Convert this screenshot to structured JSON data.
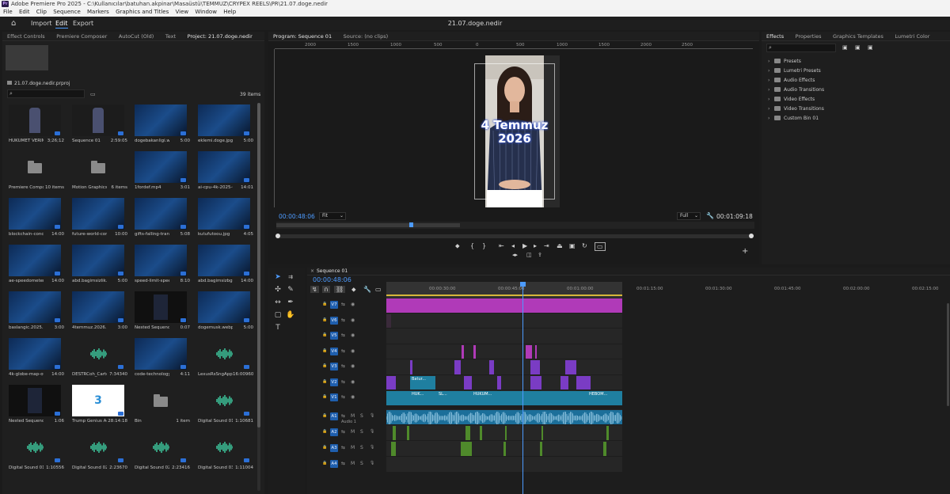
{
  "window": {
    "title": "Adobe Premiere Pro 2025 - C:\\Kullanıcılar\\batuhan.akpinar\\Masaüstü\\TEMMUZ\\CRYPEX REELS\\PR\\21.07.doge.nedir",
    "app_icon_label": "Pr"
  },
  "menu": [
    "File",
    "Edit",
    "Clip",
    "Sequence",
    "Markers",
    "Graphics and Titles",
    "View",
    "Window",
    "Help"
  ],
  "workspace": {
    "tabs": [
      "Import",
      "Edit",
      "Export"
    ],
    "active": "Edit",
    "document_title": "21.07.doge.nedir"
  },
  "project_panel": {
    "tabs": [
      "Effect Controls",
      "Premiere Composer",
      "AutoCut (Old)",
      "Text",
      "Project: 21.07.doge.nedir"
    ],
    "active_tab": "Project: 21.07.doge.nedir",
    "file_name": "21.07.doge.nedir.prproj",
    "item_count": "39 items",
    "items": [
      {
        "name": "HUKUMET VERIM...",
        "duration": "3;26;12",
        "kind": "video-portrait"
      },
      {
        "name": "Sequence 01",
        "duration": "2:59:05",
        "kind": "video-portrait"
      },
      {
        "name": "dogebakanligi.webp",
        "duration": "5:00",
        "kind": "image"
      },
      {
        "name": "eklemi.doge.jpg",
        "duration": "5:00",
        "kind": "image"
      },
      {
        "name": "Premiere Compo...",
        "duration": "10 items",
        "kind": "folder"
      },
      {
        "name": "Motion Graphics T...",
        "duration": "6 items",
        "kind": "folder"
      },
      {
        "name": "1fordef.mp4",
        "duration": "3:01",
        "kind": "video"
      },
      {
        "name": "ai-cpu-4k-2025-01-1...",
        "duration": "14:01",
        "kind": "video"
      },
      {
        "name": "blockchain-concept-...",
        "duration": "14:00",
        "kind": "video"
      },
      {
        "name": "future-world-concep...",
        "duration": "10:00",
        "kind": "video"
      },
      {
        "name": "gifts-falling-transition...",
        "duration": "5:08",
        "kind": "video"
      },
      {
        "name": "kutufutoou.jpg",
        "duration": "4:05",
        "kind": "image"
      },
      {
        "name": "ae-speedometer-and-...",
        "duration": "14:00",
        "kind": "video"
      },
      {
        "name": "abd.bagimsizlik.jpg",
        "duration": "5:00",
        "kind": "image"
      },
      {
        "name": "speed-limit-speedom...",
        "duration": "8:10",
        "kind": "video"
      },
      {
        "name": "abd.bagimsizbgn.250...",
        "duration": "14:00",
        "kind": "image"
      },
      {
        "name": "baslangic.2025.avi",
        "duration": "3:00",
        "kind": "video"
      },
      {
        "name": "4temmuz.2026.avi",
        "duration": "3:00",
        "kind": "video"
      },
      {
        "name": "Nested Sequence 01",
        "duration": "0:07",
        "kind": "sequence"
      },
      {
        "name": "dogemusk.webp",
        "duration": "5:00",
        "kind": "image"
      },
      {
        "name": "4k-globe-map-of-lar...",
        "duration": "14:00",
        "kind": "video"
      },
      {
        "name": "DESTRCoh_Carto...",
        "duration": "7:34340",
        "kind": "audio"
      },
      {
        "name": "code-technology-bac...",
        "duration": "4:11",
        "kind": "video"
      },
      {
        "name": "LexusRsSngApp...",
        "duration": "16:00960",
        "kind": "audio"
      },
      {
        "name": "Nested Sequence 02",
        "duration": "1:06",
        "kind": "sequence"
      },
      {
        "name": "Trump Genius Ac...",
        "duration": "28:14:18",
        "kind": "video",
        "thumb_text": "3"
      },
      {
        "name": "Bin",
        "duration": "1 item",
        "kind": "folder"
      },
      {
        "name": "Digital Sound 01...",
        "duration": "1:10681",
        "kind": "audio"
      },
      {
        "name": "Digital Sound 01...",
        "duration": "1:10556",
        "kind": "audio"
      },
      {
        "name": "Digital Sound 02...",
        "duration": "2:23670",
        "kind": "audio"
      },
      {
        "name": "Digital Sound 02...",
        "duration": "2:23416",
        "kind": "audio"
      },
      {
        "name": "Digital Sound 03...",
        "duration": "1:11004",
        "kind": "audio"
      }
    ]
  },
  "monitor": {
    "tabs": [
      "Program: Sequence 01",
      "Source: (no clips)"
    ],
    "active_tab": "Program: Sequence 01",
    "ruler_labels": [
      "2000",
      "1500",
      "1000",
      "500",
      "0",
      "500",
      "1000",
      "1500",
      "2000",
      "2500"
    ],
    "overlay_text_line1": "4 Temmuz",
    "overlay_text_line2": "2026",
    "current_time": "00:00:48:06",
    "zoom": "Fit",
    "quality": "Full",
    "duration": "00:01:09:18"
  },
  "effects_panel": {
    "tabs": [
      "Effects",
      "Properties",
      "Graphics Templates",
      "Lumetri Color"
    ],
    "active_tab": "Effects",
    "items": [
      "Presets",
      "Lumetri Presets",
      "Audio Effects",
      "Audio Transitions",
      "Video Effects",
      "Video Transitions",
      "Custom Bin 01"
    ]
  },
  "timeline": {
    "sequence_tab": "Sequence 01",
    "current_time": "00:00:48:06",
    "ruler_labels": [
      "00:00:30:00",
      "00:00:45:00",
      "00:01:00:00",
      "00:01:15:00",
      "00:01:30:00",
      "00:01:45:00",
      "00:02:00:00",
      "00:02:15:00"
    ],
    "video_tracks": [
      "V7",
      "V6",
      "V5",
      "V4",
      "V3",
      "V2",
      "V1"
    ],
    "audio_tracks": [
      "A1",
      "A2",
      "A3",
      "A4"
    ],
    "audio_track_name": "Audio 1",
    "clip_labels": [
      "Batur...",
      "HUK...",
      "SL...",
      "HUKUM...",
      "HEBOM..."
    ],
    "colors": {
      "pink": "#b03ab8",
      "purple": "#7a3cc4",
      "teal": "#1f7fa0",
      "green": "#4f8a2b",
      "playhead": "#4d9bff"
    }
  }
}
